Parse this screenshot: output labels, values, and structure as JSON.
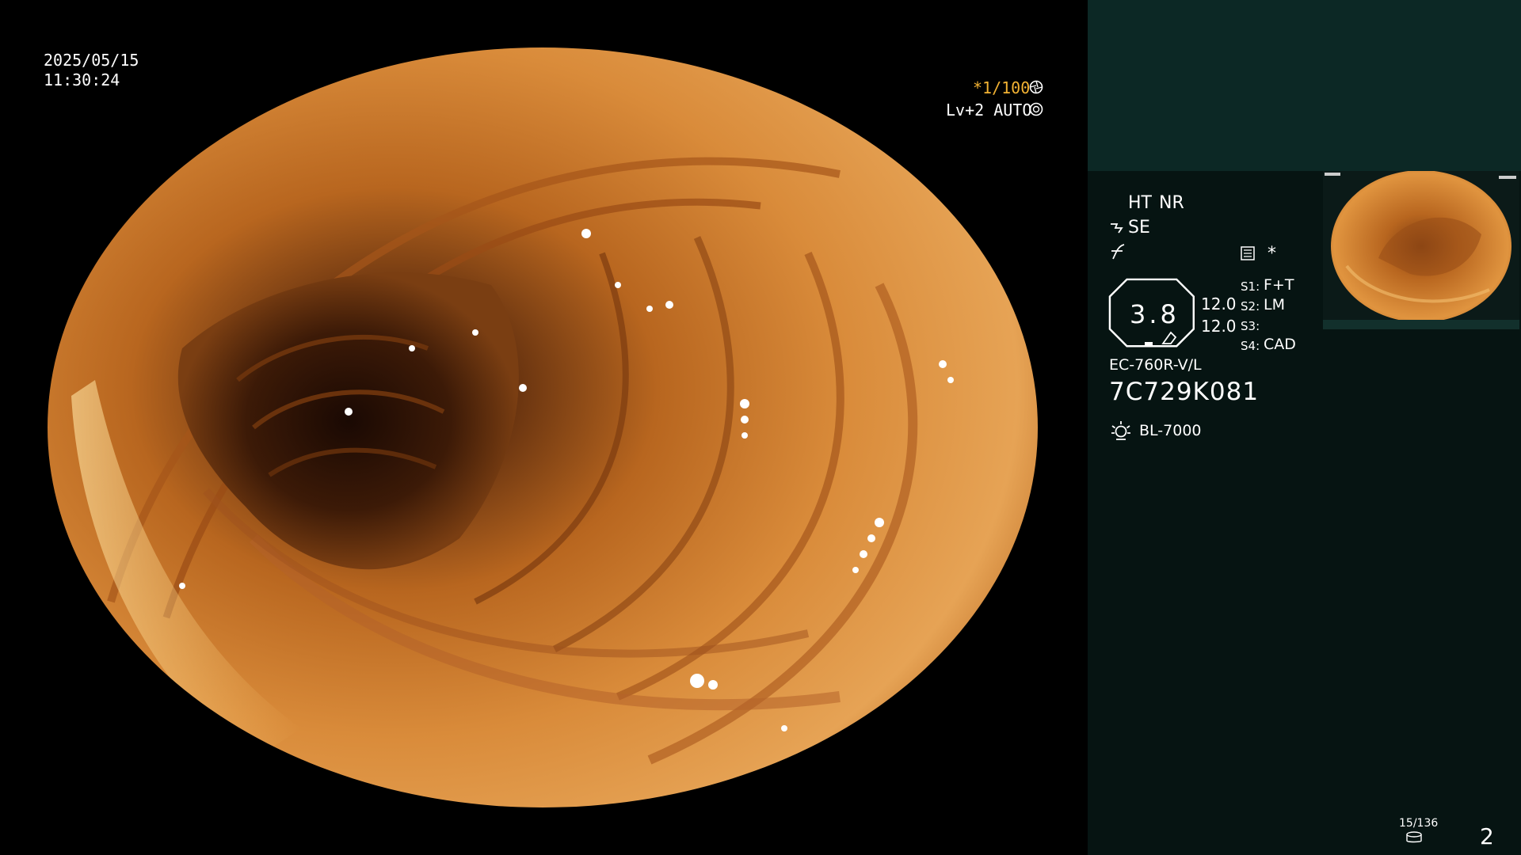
{
  "overlay": {
    "date": "2025/05/15",
    "time": "11:30:24",
    "shutter": "*1/100",
    "level": "Lv+2 AUTO"
  },
  "panel": {
    "ht": "HT",
    "nr": "NR",
    "se": "SE",
    "star": "*",
    "gauge_value": "3.8",
    "val1": "12.0",
    "val2": "12.0",
    "s1": "S1:",
    "s1_val": "F+T",
    "s2": "S2:",
    "s2_val": "LM",
    "s3": "S3:",
    "s3_val": "",
    "s4": "S4:",
    "s4_val": "CAD",
    "scope_model": "EC-760R-V/L",
    "scope_serial": "7C729K081",
    "light_source": "BL-7000",
    "image_counter": "15/136",
    "page_number": "2"
  },
  "colors": {
    "accent_yellow": "#f2b233",
    "panel_bg": "#061412",
    "panel_top_bg": "#0c2825"
  },
  "icons": [
    "aperture-icon",
    "auto-iris-icon",
    "shutter-mode-icon",
    "sharpness-icon",
    "document-icon",
    "octagon-gauge-icon",
    "light-source-icon",
    "storage-icon"
  ]
}
